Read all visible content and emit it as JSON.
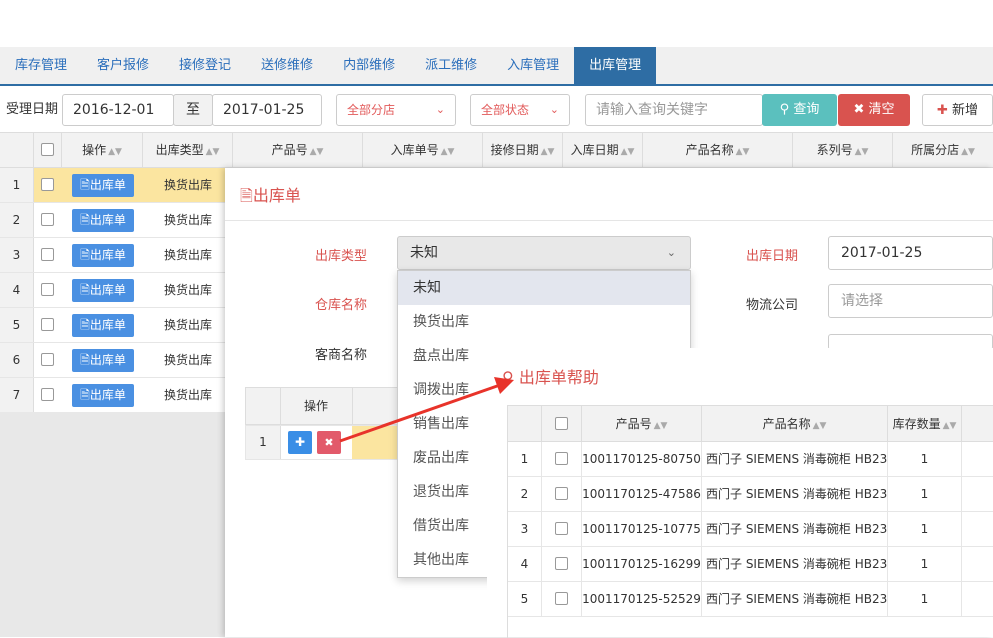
{
  "tabs": [
    "库存管理",
    "客户报修",
    "接修登记",
    "送修维修",
    "内部维修",
    "派工维修",
    "入库管理",
    "出库管理"
  ],
  "active_tab": 7,
  "toolbar": {
    "date_label": "受理日期",
    "date_from": "2016-12-01",
    "to_label": "至",
    "date_to": "2017-01-25",
    "branch_select": "全部分店",
    "status_select": "全部状态",
    "keyword_placeholder": "请输入查询关键字",
    "query_button": "查询",
    "clear_button": "清空",
    "add_button": "新增"
  },
  "grid": {
    "headers": [
      "操作",
      "出库类型",
      "产品号",
      "入库单号",
      "接修日期",
      "入库日期",
      "产品名称",
      "系列号",
      "所属分店"
    ],
    "rows": [
      {
        "no": "1",
        "action": "出库单",
        "type": "换货出库"
      },
      {
        "no": "2",
        "action": "出库单",
        "type": "换货出库"
      },
      {
        "no": "3",
        "action": "出库单",
        "type": "换货出库"
      },
      {
        "no": "4",
        "action": "出库单",
        "type": "换货出库"
      },
      {
        "no": "5",
        "action": "出库单",
        "type": "换货出库"
      },
      {
        "no": "6",
        "action": "出库单",
        "type": "换货出库"
      },
      {
        "no": "7",
        "action": "出库单",
        "type": "换货出库"
      }
    ]
  },
  "dialog": {
    "title": "出库单",
    "out_type_label": "出库类型",
    "out_type_value": "未知",
    "out_date_label": "出库日期",
    "out_date_value": "2017-01-25",
    "warehouse_label": "仓库名称",
    "logistics_label": "物流公司",
    "logistics_placeholder": "请选择",
    "customer_label": "客商名称",
    "subgrid_header_action": "操作",
    "subgrid_row_no": "1",
    "options": [
      "未知",
      "换货出库",
      "盘点出库",
      "调拨出库",
      "销售出库",
      "废品出库",
      "退货出库",
      "借货出库",
      "其他出库"
    ]
  },
  "help": {
    "title": "出库单帮助",
    "headers": [
      "产品号",
      "产品名称",
      "库存数量"
    ],
    "rows": [
      {
        "no": "1",
        "code": "1001170125-80750",
        "name": "西门子 SIEMENS 消毒碗柜 HB23",
        "qty": "1"
      },
      {
        "no": "2",
        "code": "1001170125-47586",
        "name": "西门子 SIEMENS 消毒碗柜 HB23",
        "qty": "1"
      },
      {
        "no": "3",
        "code": "1001170125-10775",
        "name": "西门子 SIEMENS 消毒碗柜 HB23",
        "qty": "1"
      },
      {
        "no": "4",
        "code": "1001170125-16299",
        "name": "西门子 SIEMENS 消毒碗柜 HB23",
        "qty": "1"
      },
      {
        "no": "5",
        "code": "1001170125-52529",
        "name": "西门子 SIEMENS 消毒碗柜 HB23",
        "qty": "1"
      }
    ]
  },
  "colors": {
    "primary": "#2e6da4",
    "danger": "#d9534f",
    "teal": "#5bc0be",
    "highlight": "#fbe5a0"
  }
}
